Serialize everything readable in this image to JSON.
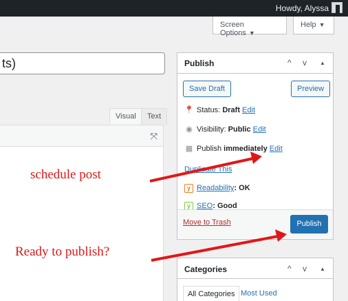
{
  "admin_bar": {
    "howdy": "Howdy, Alyssa"
  },
  "top_tabs": {
    "screen_options": "Screen Options",
    "help": "Help",
    "arrow": "▼"
  },
  "title_field": {
    "value": "ts)"
  },
  "editor": {
    "visual_tab": "Visual",
    "text_tab": "Text",
    "expand_icon": "⤧"
  },
  "publish_box": {
    "title": "Publish",
    "controls": [
      "^",
      "v",
      "▲"
    ],
    "save_draft": "Save Draft",
    "preview": "Preview",
    "status_label": "Status:",
    "status_value": "Draft",
    "visibility_label": "Visibility:",
    "visibility_value": "Public",
    "publish_label": "Publish",
    "publish_value": "immediately",
    "edit": "Edit",
    "duplicate": "Duplicate This",
    "readability_label": "Readability",
    "readability_value": ": OK",
    "seo_label": "SEO",
    "seo_value": ": Good",
    "yoast_glyph": "y",
    "move_to_trash": "Move to Trash",
    "publish_button": "Publish"
  },
  "categories_box": {
    "title": "Categories",
    "tab_all": "All Categories",
    "tab_used": "Most Used"
  },
  "annotations": {
    "schedule": "schedule post",
    "ready": "Ready to publish?"
  },
  "colors": {
    "annotation_red": "#e11717",
    "wp_blue": "#2271b1",
    "admin_bar": "#1d2327"
  }
}
